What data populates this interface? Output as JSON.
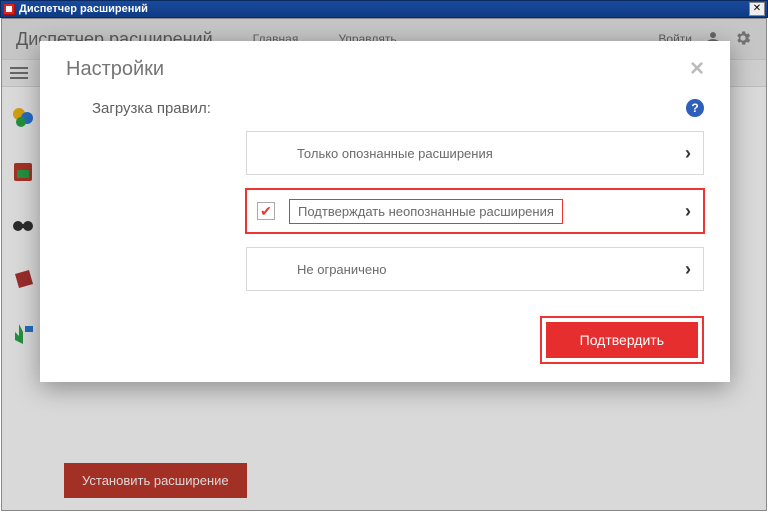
{
  "window": {
    "title": "Диспетчер расширений"
  },
  "header": {
    "app_title": "Диспетчер расширений",
    "nav": {
      "home": "Главная",
      "manage": "Управлять"
    },
    "login": "Войти"
  },
  "install_button": "Установить расширение",
  "modal": {
    "title": "Настройки",
    "section_label": "Загрузка правил:",
    "options": [
      {
        "label": "Только опознанные расширения",
        "selected": false
      },
      {
        "label": "Подтверждать неопознанные расширения",
        "selected": true
      },
      {
        "label": "Не ограничено",
        "selected": false
      }
    ],
    "confirm": "Подтвердить"
  }
}
